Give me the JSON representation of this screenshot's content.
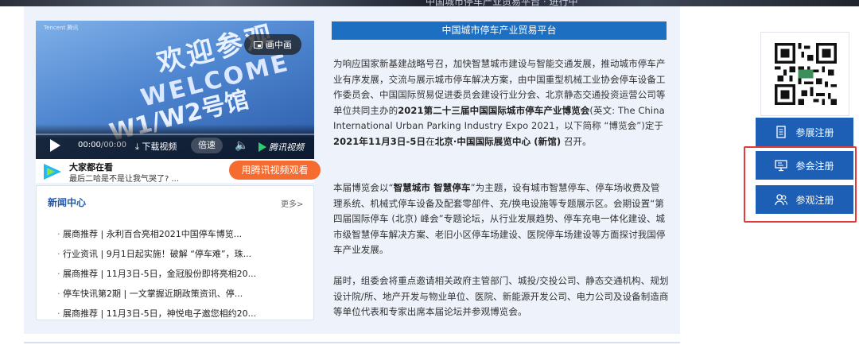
{
  "top_strip": {
    "caption": "中国城市停车产业贸易平台 · 进行中"
  },
  "video": {
    "banner_line1": "欢迎参观",
    "banner_line2": "WELCOME",
    "banner_line3": "W1/W2号馆",
    "logo_text": "Tencent 腾讯",
    "pip_label": "画中画",
    "time_current": "00:00",
    "time_total": "/00:00",
    "download_label": "下载视频",
    "speed_label": "倍速",
    "brand_label": "腾讯视频"
  },
  "promo": {
    "title": "大家都在看",
    "subtitle": "最后二哈是不是让我气哭了? ...",
    "button": "用腾讯视频观看"
  },
  "news": {
    "heading": "新闻中心",
    "more": "更多>",
    "items": [
      "展商推荐 | 永利百合亮相2021中国停车博览...",
      "行业资讯 | 9月1日起实施！破解 “停车难”，珠...",
      "展商推荐 | 11月3日-5日，金冠股份即将亮相20...",
      "停车快讯第2期 | 一文掌握近期政策资讯、停...",
      "展商推荐 | 11月3日-5日，神悦电子邀您相约20..."
    ]
  },
  "article": {
    "title": "中国城市停车产业贸易平台",
    "p1_a": "为响应国家新基建战略号召，加快智慧城市建设与智能交通发展，推动城市停车产业有序发展，交流与展示城市停车解决方案，由中国重型机械工业协会停车设备工作委员会、中国国际贸易促进委员会建设行业分会、北京静态交通投资运营公司等单位共同主办的",
    "p1_b": "2021第二十三届中国国际城市停车产业博览会",
    "p1_c": "(英文: The China International Urban Parking Industry Expo 2021，以下简称 “博览会”)定于",
    "p1_d": "2021年11月3日-5日",
    "p1_e": "在",
    "p1_f": "北京·中国国际展览中心 (新馆)",
    "p1_g": " 召开。",
    "p2_a": "本届博览会以“",
    "p2_b": "智慧城市 智慧停车",
    "p2_c": "”为主题，设有城市智慧停车、停车场收费及管理系统、机械式停车设备及配套零部件、充/换电设施等专题展示区。会期设置“第四届国际停车 (北京) 峰会”专题论坛，从行业发展趋势、停车充电一体化建设、城市级智慧停车解决方案、老旧小区停车场建设、医院停车场建设等方面探讨我国停车产业发展。",
    "p3": "届时，组委会将重点邀请相关政府主管部门、城投/交投公司、静态交通机构、规划设计院/所、地产开发与物业单位、医院、新能源开发公司、电力公司及设备制造商等单位代表和专家出席本届论坛并参观博览会。"
  },
  "sidebar": {
    "buttons": [
      {
        "label": "参展注册",
        "icon": "document-icon"
      },
      {
        "label": "参会注册",
        "icon": "presentation-icon"
      },
      {
        "label": "参观注册",
        "icon": "users-icon"
      }
    ],
    "colors": {
      "button_bg": "#1d5fb4",
      "highlight": "#e23a3a"
    }
  }
}
